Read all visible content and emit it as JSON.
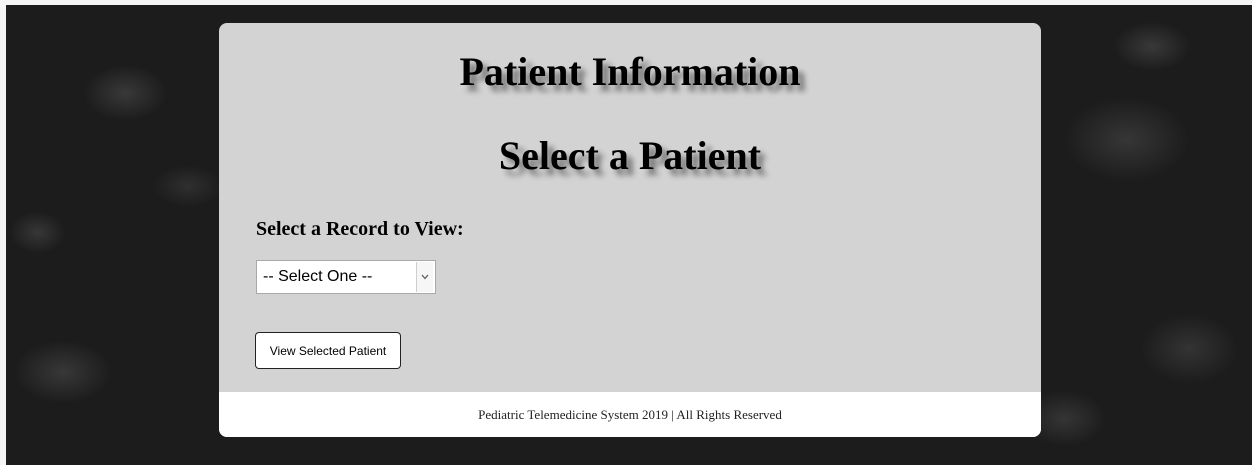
{
  "header": {
    "title": "Patient Information",
    "subtitle": "Select a Patient"
  },
  "form": {
    "record_label": "Select a Record to View:",
    "select": {
      "selected": "-- Select One --"
    },
    "view_button_label": "View Selected Patient"
  },
  "footer": {
    "text": "Pediatric Telemedicine System 2019 | All Rights Reserved"
  },
  "colors": {
    "card_background": "#d3d3d3",
    "page_background": "#1c1c1c",
    "footer_background": "#ffffff"
  },
  "icons": {
    "select_arrow": "chevron-down-icon"
  }
}
